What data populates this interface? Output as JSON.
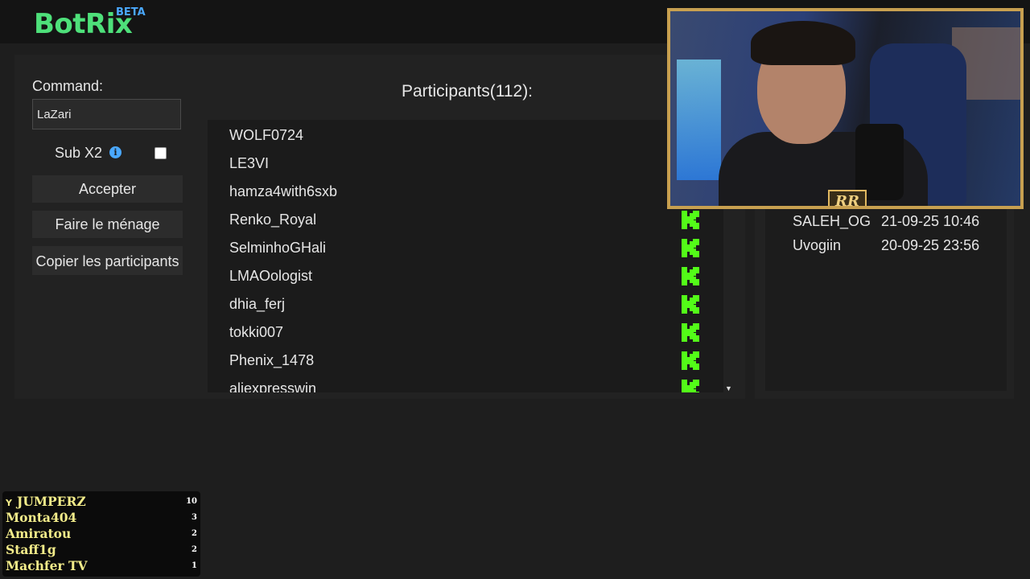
{
  "app": {
    "name": "BotRix",
    "badge": "BETA"
  },
  "colors": {
    "brand": "#4ee07a",
    "badge": "#4aa8ff",
    "kick": "#53fc18",
    "frame": "#c8a050",
    "leaderboard_text": "#f3ec8a"
  },
  "command": {
    "label": "Command:",
    "value": "LaZari"
  },
  "sub": {
    "label": "Sub X2",
    "info_icon": "info-icon",
    "checked": false
  },
  "buttons": {
    "accept": "Accepter",
    "clean": "Faire le ménage",
    "copy": "Copier les participants"
  },
  "participants": {
    "title": "Participants(112):",
    "platform_icon": "kick-icon",
    "list": [
      "WOLF0724",
      "LE3VI",
      "hamza4with6sxb",
      "Renko_Royal",
      "SelminhoGHali",
      "LMAOologist",
      "dhia_ferj",
      "tokki007",
      "Phenix_1478",
      "aliexpresswin"
    ]
  },
  "history": [
    {
      "name": "SALEH_OG",
      "date": "21-09-25 10:46"
    },
    {
      "name": "Uvogiin",
      "date": "20-09-25 23:56"
    }
  ],
  "webcam": {
    "badge_text": "RR"
  },
  "leaderboard": {
    "trophy_icon": "trophy-icon",
    "entries": [
      {
        "name": "JUMPERZ",
        "score": "10"
      },
      {
        "name": "Monta404",
        "score": "3"
      },
      {
        "name": "Amiratou",
        "score": "2"
      },
      {
        "name": "Staff1g",
        "score": "2"
      },
      {
        "name": "Machfer TV",
        "score": "1"
      }
    ]
  }
}
